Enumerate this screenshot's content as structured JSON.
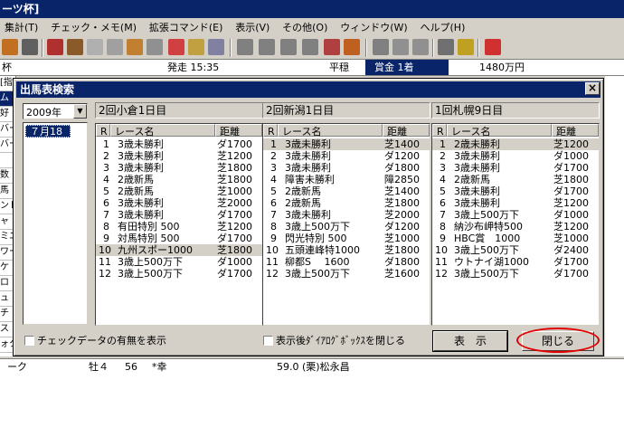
{
  "app": {
    "title_partial": "ーツ杯]",
    "menus": [
      "集計(T)",
      "チェック・メモ(M)",
      "拡張コマンド(E)",
      "表示(V)",
      "その他(O)",
      "ウィンドウ(W)",
      "ヘルプ(H)"
    ],
    "info": {
      "left": "杯",
      "start_time": "発走 15:35",
      "condition": "平穏",
      "prize_label": "賞金 1着",
      "prize_value": "1480万円"
    },
    "left_strip": [
      "[指",
      "ム",
      "好",
      "バー",
      "バー",
      "",
      "数",
      "馬",
      "ンド",
      "ャ",
      "ミニ",
      "ワー",
      "ケ",
      "ロ",
      "ュ",
      "チ",
      "ス",
      "ォク"
    ],
    "bottom_row": {
      "name": "ーク",
      "sex_age": "牡４",
      "weight": "56",
      "mark": "*幸",
      "jockey_weight": "59.0 (栗)松永昌"
    }
  },
  "dialog": {
    "title": "出馬表検索",
    "year": "2009年",
    "dates": [
      "７月18日"
    ],
    "columns": {
      "r": "R",
      "name": "レース名",
      "dist": "距離"
    },
    "venues": [
      {
        "name": "2回小倉1日目",
        "races": [
          {
            "r": "1",
            "name": "3歳未勝利",
            "dist": "ダ1700"
          },
          {
            "r": "2",
            "name": "3歳未勝利",
            "dist": "芝1200"
          },
          {
            "r": "3",
            "name": "3歳未勝利",
            "dist": "芝1800"
          },
          {
            "r": "4",
            "name": "2歳新馬",
            "dist": "芝1800"
          },
          {
            "r": "5",
            "name": "2歳新馬",
            "dist": "芝1000"
          },
          {
            "r": "6",
            "name": "3歳未勝利",
            "dist": "芝2000"
          },
          {
            "r": "7",
            "name": "3歳未勝利",
            "dist": "ダ1700"
          },
          {
            "r": "8",
            "name": "有田特別 500",
            "dist": "芝1200"
          },
          {
            "r": "9",
            "name": "対馬特別 500",
            "dist": "ダ1700"
          },
          {
            "r": "10",
            "name": "九州スポー1000",
            "dist": "芝1800"
          },
          {
            "r": "11",
            "name": "3歳上500万下",
            "dist": "ダ1000"
          },
          {
            "r": "12",
            "name": "3歳上500万下",
            "dist": "ダ1700"
          }
        ]
      },
      {
        "name": "2回新潟1日目",
        "races": [
          {
            "r": "1",
            "name": "3歳未勝利",
            "dist": "芝1400"
          },
          {
            "r": "2",
            "name": "3歳未勝利",
            "dist": "ダ1200"
          },
          {
            "r": "3",
            "name": "3歳未勝利",
            "dist": "ダ1800"
          },
          {
            "r": "4",
            "name": "障害未勝利",
            "dist": "障2850"
          },
          {
            "r": "5",
            "name": "2歳新馬",
            "dist": "芝1400"
          },
          {
            "r": "6",
            "name": "2歳新馬",
            "dist": "芝1800"
          },
          {
            "r": "7",
            "name": "3歳未勝利",
            "dist": "芝2000"
          },
          {
            "r": "8",
            "name": "3歳上500万下",
            "dist": "ダ1200"
          },
          {
            "r": "9",
            "name": "閃光特別 500",
            "dist": "芝1000"
          },
          {
            "r": "10",
            "name": "五頭連峰特1000",
            "dist": "芝1800"
          },
          {
            "r": "11",
            "name": "柳都S　 1600",
            "dist": "ダ1800"
          },
          {
            "r": "12",
            "name": "3歳上500万下",
            "dist": "芝1600"
          }
        ]
      },
      {
        "name": "1回札幌9日目",
        "races": [
          {
            "r": "1",
            "name": "2歳未勝利",
            "dist": "芝1200"
          },
          {
            "r": "2",
            "name": "3歳未勝利",
            "dist": "ダ1000"
          },
          {
            "r": "3",
            "name": "3歳未勝利",
            "dist": "ダ1700"
          },
          {
            "r": "4",
            "name": "2歳新馬",
            "dist": "芝1800"
          },
          {
            "r": "5",
            "name": "3歳未勝利",
            "dist": "ダ1700"
          },
          {
            "r": "6",
            "name": "3歳未勝利",
            "dist": "芝1200"
          },
          {
            "r": "7",
            "name": "3歳上500万下",
            "dist": "ダ1000"
          },
          {
            "r": "8",
            "name": "納沙布岬特500",
            "dist": "芝1200"
          },
          {
            "r": "9",
            "name": "HBC賞　1000",
            "dist": "芝1000"
          },
          {
            "r": "10",
            "name": "3歳上500万下",
            "dist": "ダ2400"
          },
          {
            "r": "11",
            "name": "ウトナイ湖1000",
            "dist": "ダ1700"
          },
          {
            "r": "12",
            "name": "3歳上500万下",
            "dist": "ダ1700"
          }
        ]
      }
    ],
    "checkbox_check_data": "チェックデータの有無を表示",
    "checkbox_close_after": "表示後ﾀﾞｲｱﾛｸﾞﾎﾞｯｸｽを閉じる",
    "display_button": "表　示",
    "close_button": "閉じる",
    "close_x": "×"
  },
  "colors": {
    "titlebar": "#0a246a",
    "highlight": "#e00000"
  }
}
